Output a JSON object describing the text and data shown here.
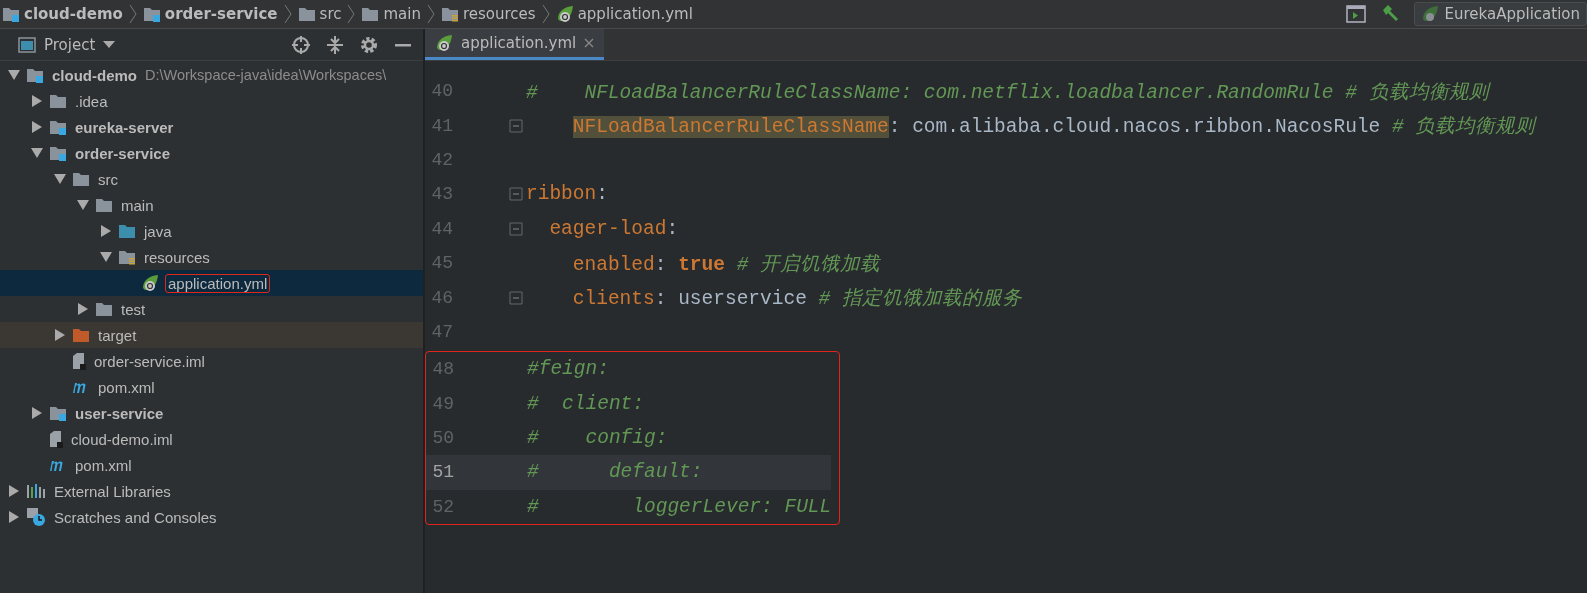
{
  "breadcrumbs": [
    {
      "label": "cloud-demo",
      "kind": "module"
    },
    {
      "label": "order-service",
      "kind": "module"
    },
    {
      "label": "src",
      "kind": "folder"
    },
    {
      "label": "main",
      "kind": "folder"
    },
    {
      "label": "resources",
      "kind": "resources-folder"
    },
    {
      "label": "application.yml",
      "kind": "yml"
    }
  ],
  "run_config": {
    "label": "EurekaApplication"
  },
  "project_panel": {
    "title": "Project"
  },
  "tree": [
    {
      "label": "cloud-demo",
      "path": "D:\\Workspace-java\\idea\\Workspaces\\",
      "kind": "module",
      "bold": true,
      "expanded": true,
      "selected": false,
      "children": [
        {
          "label": ".idea",
          "kind": "folder",
          "bold": false,
          "expanded": false,
          "selected": false
        },
        {
          "label": "eureka-server",
          "kind": "module",
          "bold": true,
          "expanded": false,
          "selected": false
        },
        {
          "label": "order-service",
          "kind": "module",
          "bold": true,
          "expanded": true,
          "selected": false,
          "children": [
            {
              "label": "src",
              "kind": "folder",
              "bold": false,
              "expanded": true,
              "selected": false,
              "children": [
                {
                  "label": "main",
                  "kind": "folder",
                  "bold": false,
                  "expanded": true,
                  "selected": false,
                  "children": [
                    {
                      "label": "java",
                      "kind": "source-folder",
                      "bold": false,
                      "expanded": false,
                      "selected": false
                    },
                    {
                      "label": "resources",
                      "kind": "resources-folder",
                      "bold": false,
                      "expanded": true,
                      "selected": false,
                      "children": [
                        {
                          "label": "application.yml",
                          "kind": "yml",
                          "bold": false,
                          "selected": true,
                          "outlined": true
                        }
                      ]
                    }
                  ]
                },
                {
                  "label": "test",
                  "kind": "folder",
                  "bold": false,
                  "expanded": false,
                  "selected": false
                }
              ]
            },
            {
              "label": "target",
              "kind": "excluded-folder",
              "bold": false,
              "expanded": false,
              "selected": false
            },
            {
              "label": "order-service.iml",
              "kind": "iml",
              "bold": false,
              "selected": false
            },
            {
              "label": "pom.xml",
              "kind": "maven",
              "bold": false,
              "selected": false
            }
          ]
        },
        {
          "label": "user-service",
          "kind": "module",
          "bold": true,
          "expanded": false,
          "selected": false
        },
        {
          "label": "cloud-demo.iml",
          "kind": "iml",
          "bold": false,
          "selected": false
        },
        {
          "label": "pom.xml",
          "kind": "maven",
          "bold": false,
          "selected": false
        }
      ]
    },
    {
      "label": "External Libraries",
      "kind": "libraries",
      "bold": false,
      "expanded": false,
      "selected": false
    },
    {
      "label": "Scratches and Consoles",
      "kind": "scratches",
      "bold": false,
      "expanded": false,
      "selected": false
    }
  ],
  "editor_tabs": [
    {
      "label": "application.yml",
      "selected": true
    }
  ],
  "code_lines": [
    {
      "number": "40",
      "fold": false,
      "current": false,
      "boxed": false,
      "tokens": [
        {
          "kind": "comment",
          "text": "#    NFLoadBalancerRuleClassName: com.netflix.loadbalancer.RandomRule # 负载均衡规则"
        }
      ]
    },
    {
      "number": "41",
      "fold": true,
      "current": false,
      "boxed": false,
      "tokens": [
        {
          "kind": "key",
          "text": "    NFLoadBalancerRuleClassName",
          "marked": true
        },
        {
          "kind": "plain",
          "text": ": com.alibaba.cloud.nacos.ribbon.NacosRule "
        },
        {
          "kind": "comment",
          "text": "# 负载均衡规则"
        }
      ]
    },
    {
      "number": "42",
      "fold": false,
      "current": false,
      "boxed": false
    },
    {
      "number": "43",
      "fold": true,
      "current": false,
      "boxed": false,
      "tokens": [
        {
          "kind": "key",
          "text": "ribbon"
        },
        {
          "kind": "plain",
          "text": ":"
        }
      ]
    },
    {
      "number": "44",
      "fold": true,
      "current": false,
      "boxed": false,
      "tokens": [
        {
          "kind": "key",
          "text": "  eager-load"
        },
        {
          "kind": "plain",
          "text": ":"
        }
      ]
    },
    {
      "number": "45",
      "fold": false,
      "current": false,
      "boxed": false,
      "tokens": [
        {
          "kind": "key",
          "text": "    enabled"
        },
        {
          "kind": "plain",
          "text": ": "
        },
        {
          "kind": "bool",
          "text": "true"
        },
        {
          "kind": "comment",
          "text": " # 开启饥饿加载"
        }
      ]
    },
    {
      "number": "46",
      "fold": true,
      "current": false,
      "boxed": false,
      "tokens": [
        {
          "kind": "key",
          "text": "    clients"
        },
        {
          "kind": "plain",
          "text": ": userservice "
        },
        {
          "kind": "comment",
          "text": "# 指定饥饿加载的服务"
        }
      ]
    },
    {
      "number": "47",
      "fold": false,
      "current": false,
      "boxed": false
    },
    {
      "number": "48",
      "fold": false,
      "current": false,
      "boxed": true,
      "tokens": [
        {
          "kind": "comment",
          "text": "#feign:"
        }
      ]
    },
    {
      "number": "49",
      "fold": false,
      "current": false,
      "boxed": true,
      "tokens": [
        {
          "kind": "comment",
          "text": "#  client:"
        }
      ]
    },
    {
      "number": "50",
      "fold": false,
      "current": false,
      "boxed": true,
      "tokens": [
        {
          "kind": "comment",
          "text": "#    config:"
        }
      ]
    },
    {
      "number": "51",
      "fold": false,
      "current": true,
      "boxed": true,
      "tokens": [
        {
          "kind": "comment",
          "text": "#      default:"
        }
      ]
    },
    {
      "number": "52",
      "fold": false,
      "current": false,
      "boxed": true,
      "tokens": [
        {
          "kind": "comment",
          "text": "#        loggerLever: FULL"
        }
      ]
    }
  ]
}
